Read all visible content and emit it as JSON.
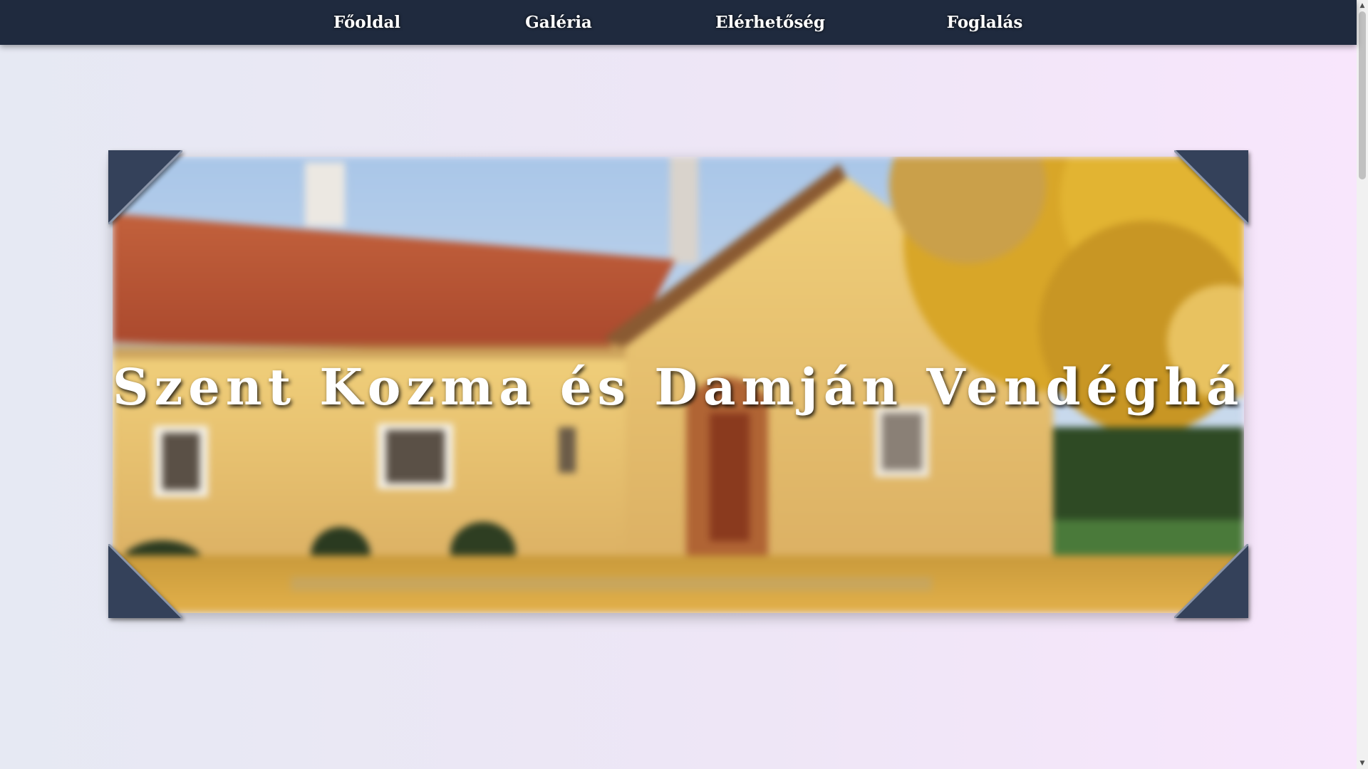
{
  "nav": {
    "items": [
      {
        "label": "Főoldal"
      },
      {
        "label": "Galéria"
      },
      {
        "label": "Elérhetőség"
      },
      {
        "label": "Foglalás"
      }
    ]
  },
  "hero": {
    "title": "Szent Kozma és Damján Vendégház",
    "image": "guesthouse-autumn-photo"
  },
  "scrollbar": {
    "up_icon": "triangle-up-icon",
    "down_icon": "triangle-down-icon",
    "up_glyph": "▲",
    "down_glyph": "▼"
  },
  "colors": {
    "nav_background": "#1f2a3e",
    "corner_fill": "#34415a",
    "background_left": "#e6e9f3",
    "background_right": "#f8e6fc"
  }
}
